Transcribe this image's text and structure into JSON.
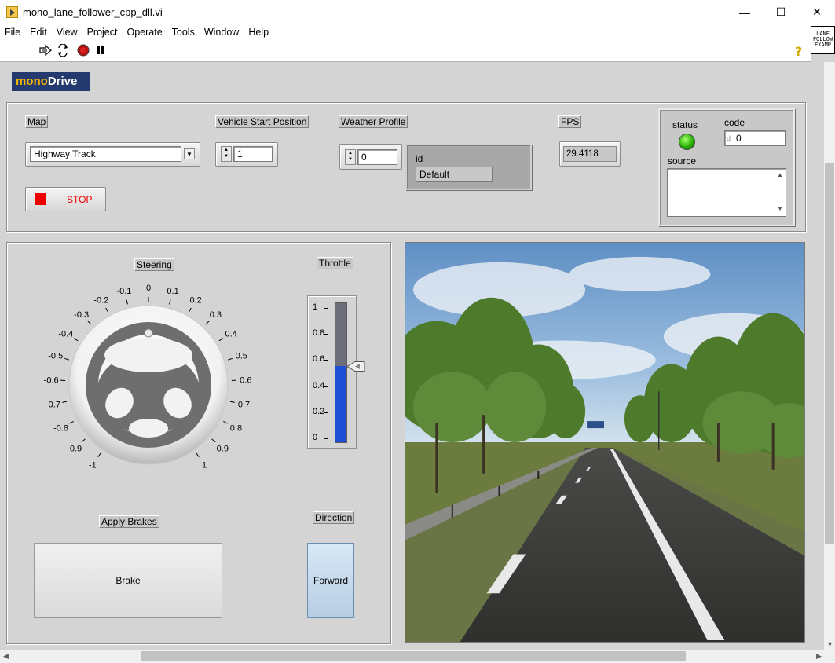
{
  "window": {
    "title": "mono_lane_follower_cpp_dll.vi",
    "min_glyph": "—",
    "max_glyph": "☐",
    "close_glyph": "✕"
  },
  "menu": [
    "File",
    "Edit",
    "View",
    "Project",
    "Operate",
    "Tools",
    "Window",
    "Help"
  ],
  "vi_icon_lines": [
    "LANE",
    "FOLLOW",
    "EXAMP"
  ],
  "toolbar": {
    "icons": [
      "run-arrow-icon",
      "run-continuously-icon",
      "abort-icon",
      "pause-icon",
      "help-icon"
    ],
    "help_glyph": "?"
  },
  "logo": {
    "mono": "mono",
    "drive": "Drive"
  },
  "map": {
    "label": "Map",
    "value": "Highway Track"
  },
  "vehicle_start": {
    "label": "Vehicle Start Position",
    "value": "1"
  },
  "stop": {
    "label": "STOP"
  },
  "weather": {
    "label": "Weather Profile",
    "index": "0",
    "id_label": "id",
    "id_value": "Default"
  },
  "fps": {
    "label": "FPS",
    "value": "29.4118"
  },
  "error": {
    "status_label": "status",
    "code_label": "code",
    "code_value": "0",
    "code_radix": "d",
    "source_label": "source",
    "source_value": ""
  },
  "steering": {
    "label": "Steering",
    "value": 0,
    "ticks": [
      "-1",
      "-0.9",
      "-0.8",
      "-0.7",
      "-0.6",
      "-0.5",
      "-0.4",
      "-0.3",
      "-0.2",
      "-0.1",
      "0",
      "0.1",
      "0.2",
      "0.3",
      "0.4",
      "0.5",
      "0.6",
      "0.7",
      "0.8",
      "0.9",
      "1"
    ]
  },
  "throttle": {
    "label": "Throttle",
    "value": 0.55,
    "scale": [
      "1",
      "0.8",
      "0.6",
      "0.4",
      "0.2",
      "0"
    ]
  },
  "brakes": {
    "label": "Apply Brakes",
    "button": "Brake"
  },
  "direction": {
    "label": "Direction",
    "button": "Forward"
  },
  "colors": {
    "led_on": "#22aa00",
    "throttle_fill": "#1f4fd4",
    "stop_red": "#ee0000",
    "logo_bg": "#243a6e",
    "logo_accent": "#f5b800"
  }
}
